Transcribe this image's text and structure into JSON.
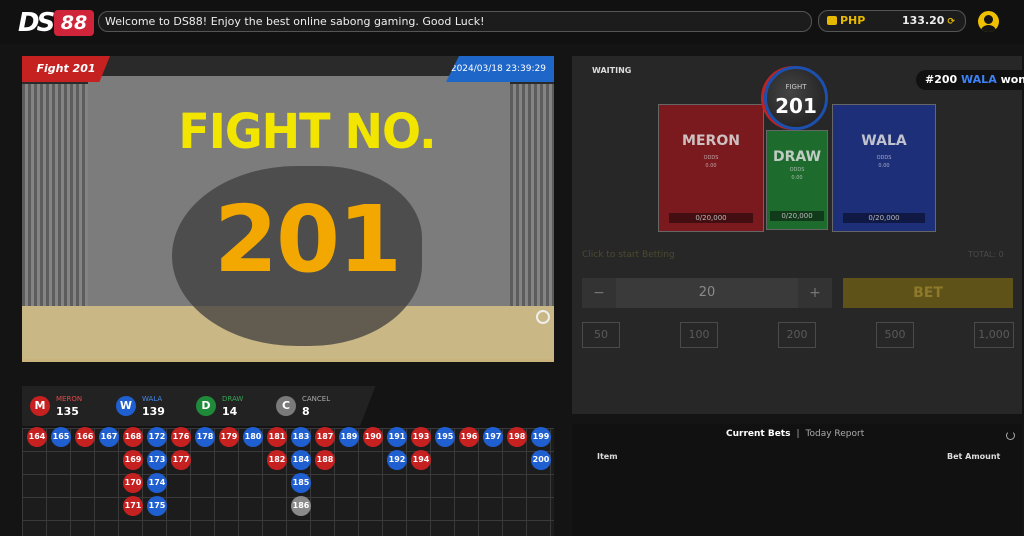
{
  "header": {
    "logo_text": "DS88",
    "marquee": "Welcome to DS88!   Enjoy the best online sabong gaming. Good Luck!",
    "wallet": {
      "currency": "PHP",
      "balance": "133.20"
    }
  },
  "video": {
    "fight_tag": "Fight 201",
    "datetime": "2024/03/18 23:39:29",
    "overlay_title": "FIGHT NO.",
    "overlay_number": "201"
  },
  "stats": [
    {
      "letter": "M",
      "label": "MERON",
      "value": "135",
      "color": "#c62121"
    },
    {
      "letter": "W",
      "label": "WALA",
      "value": "139",
      "color": "#1f5fd0"
    },
    {
      "letter": "D",
      "label": "DRAW",
      "value": "14",
      "color": "#1f8a3a"
    },
    {
      "letter": "C",
      "label": "CANCEL",
      "value": "8",
      "color": "#7a7a7a"
    }
  ],
  "history": [
    {
      "n": "164",
      "s": "m",
      "c": 0,
      "r": 0
    },
    {
      "n": "165",
      "s": "w",
      "c": 1,
      "r": 0
    },
    {
      "n": "166",
      "s": "m",
      "c": 2,
      "r": 0
    },
    {
      "n": "167",
      "s": "w",
      "c": 3,
      "r": 0
    },
    {
      "n": "168",
      "s": "m",
      "c": 4,
      "r": 0
    },
    {
      "n": "169",
      "s": "m",
      "c": 4,
      "r": 1
    },
    {
      "n": "170",
      "s": "m",
      "c": 4,
      "r": 2
    },
    {
      "n": "171",
      "s": "m",
      "c": 4,
      "r": 3
    },
    {
      "n": "172",
      "s": "w",
      "c": 5,
      "r": 0
    },
    {
      "n": "173",
      "s": "w",
      "c": 5,
      "r": 1
    },
    {
      "n": "174",
      "s": "w",
      "c": 5,
      "r": 2
    },
    {
      "n": "175",
      "s": "w",
      "c": 5,
      "r": 3
    },
    {
      "n": "176",
      "s": "m",
      "c": 6,
      "r": 0
    },
    {
      "n": "177",
      "s": "m",
      "c": 6,
      "r": 1
    },
    {
      "n": "178",
      "s": "w",
      "c": 7,
      "r": 0
    },
    {
      "n": "179",
      "s": "m",
      "c": 8,
      "r": 0
    },
    {
      "n": "180",
      "s": "w",
      "c": 9,
      "r": 0
    },
    {
      "n": "181",
      "s": "m",
      "c": 10,
      "r": 0
    },
    {
      "n": "182",
      "s": "m",
      "c": 10,
      "r": 1
    },
    {
      "n": "183",
      "s": "w",
      "c": 11,
      "r": 0
    },
    {
      "n": "184",
      "s": "w",
      "c": 11,
      "r": 1
    },
    {
      "n": "185",
      "s": "w",
      "c": 11,
      "r": 2
    },
    {
      "n": "186",
      "s": "c",
      "c": 11,
      "r": 3
    },
    {
      "n": "187",
      "s": "m",
      "c": 12,
      "r": 0
    },
    {
      "n": "188",
      "s": "m",
      "c": 12,
      "r": 1
    },
    {
      "n": "189",
      "s": "w",
      "c": 13,
      "r": 0
    },
    {
      "n": "190",
      "s": "m",
      "c": 14,
      "r": 0
    },
    {
      "n": "191",
      "s": "w",
      "c": 15,
      "r": 0
    },
    {
      "n": "192",
      "s": "w",
      "c": 15,
      "r": 1
    },
    {
      "n": "193",
      "s": "m",
      "c": 16,
      "r": 0
    },
    {
      "n": "194",
      "s": "m",
      "c": 16,
      "r": 1
    },
    {
      "n": "195",
      "s": "w",
      "c": 17,
      "r": 0
    },
    {
      "n": "196",
      "s": "m",
      "c": 18,
      "r": 0
    },
    {
      "n": "197",
      "s": "w",
      "c": 19,
      "r": 0
    },
    {
      "n": "198",
      "s": "m",
      "c": 20,
      "r": 0
    },
    {
      "n": "199",
      "s": "w",
      "c": 21,
      "r": 0
    },
    {
      "n": "200",
      "s": "w",
      "c": 21,
      "r": 1
    }
  ],
  "colors": {
    "meron": "#c62121",
    "wala": "#1f5fd0",
    "draw": "#1f8a3a",
    "cancel": "#8a8a8a"
  },
  "betting": {
    "status": "WAITING",
    "last_result": {
      "prefix": "#200",
      "side": "WALA",
      "suffix": "won"
    },
    "fight_label": "FIGHT",
    "fight_number": "201",
    "meron": {
      "name": "MERON",
      "odds_label": "ODDS",
      "odds": "0.00",
      "pool": "0/20,000"
    },
    "draw": {
      "name": "DRAW",
      "odds_label": "ODDS",
      "odds": "0.00",
      "pool": "0/20,000"
    },
    "wala": {
      "name": "WALA",
      "odds_label": "ODDS",
      "odds": "0.00",
      "pool": "0/20,000"
    },
    "hint": "Click to start Betting",
    "total": "TOTAL: 0",
    "amount": "20",
    "minus": "−",
    "plus": "+",
    "bet_label": "BET",
    "quick_amounts": [
      "50",
      "100",
      "200",
      "500",
      "1,000"
    ]
  },
  "bets": {
    "tab_current": "Current Bets",
    "separator": "|",
    "tab_report": "Today Report",
    "col_item": "Item",
    "col_amount": "Bet Amount"
  }
}
